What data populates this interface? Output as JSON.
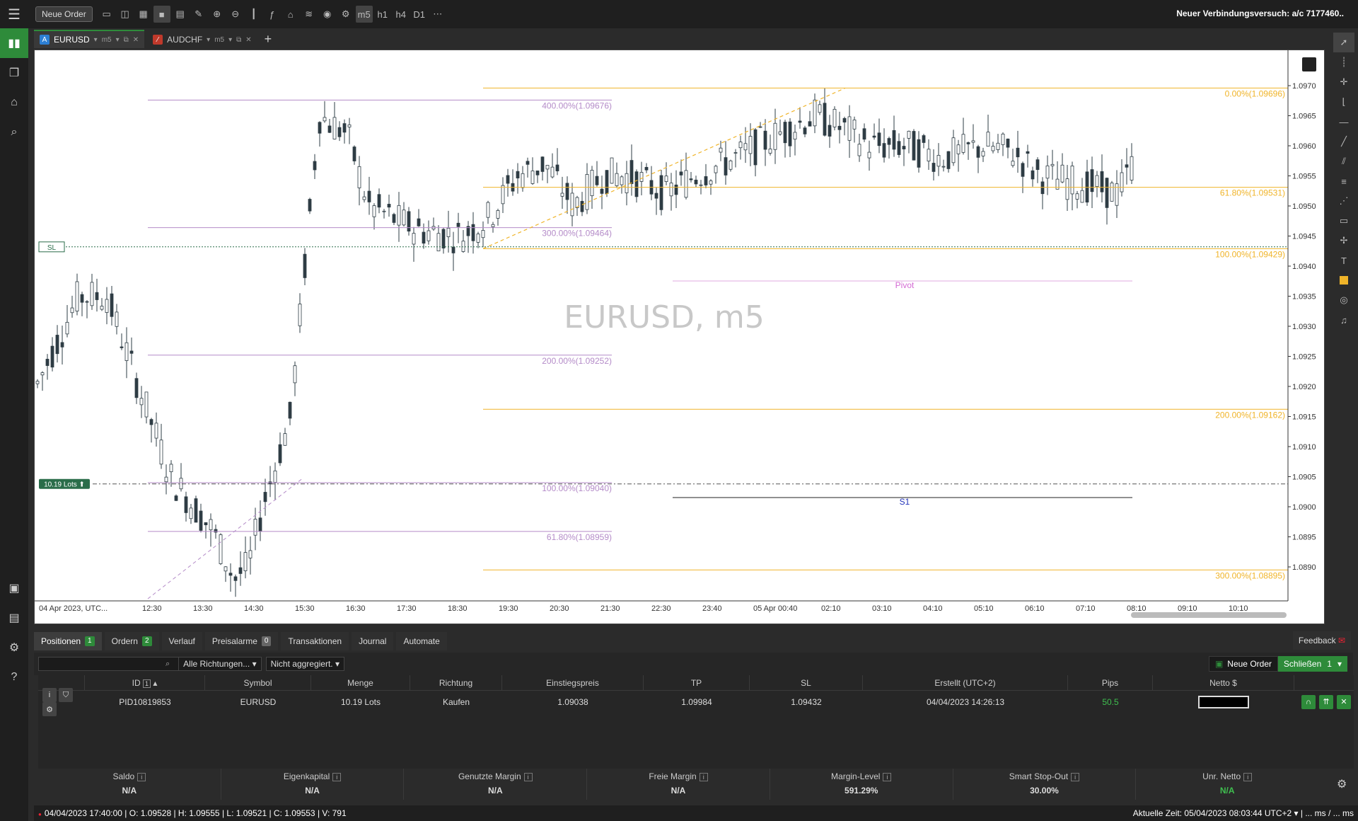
{
  "topbar": {
    "new_order_label": "Neue Order",
    "connection_status": "Neuer Verbindungsversuch: a/c 7177460..",
    "timeframes": [
      "m5",
      "h1",
      "h4",
      "D1"
    ],
    "more": "⋯"
  },
  "tabs": [
    {
      "symbol": "EURUSD",
      "timeframe": "m5",
      "badge": "A",
      "badge_color": "#2d7fd3"
    },
    {
      "symbol": "AUDCHF",
      "timeframe": "m5",
      "badge": "",
      "badge_color": "#c0392b"
    }
  ],
  "chart": {
    "watermark": "EURUSD, m5",
    "sl_label": "SL",
    "lots_label": "10.19 Lots",
    "pivot_label": "Pivot",
    "s1_label": "S1",
    "fib_purple": [
      {
        "label": "400.00%(1.09676)",
        "price": 1.09676
      },
      {
        "label": "300.00%(1.09464)",
        "price": 1.09464
      },
      {
        "label": "200.00%(1.09252)",
        "price": 1.09252
      },
      {
        "label": "100.00%(1.09040)",
        "price": 1.0904
      },
      {
        "label": "61.80%(1.08959)",
        "price": 1.08959
      }
    ],
    "fib_yellow": [
      {
        "label": "0.00%(1.09696)",
        "price": 1.09696
      },
      {
        "label": "61.80%(1.09531)",
        "price": 1.09531
      },
      {
        "label": "100.00%(1.09429)",
        "price": 1.09429
      },
      {
        "label": "200.00%(1.09162)",
        "price": 1.09162
      },
      {
        "label": "300.00%(1.08895)",
        "price": 1.08895
      }
    ],
    "price_ticks": [
      "1.0970",
      "1.0965",
      "1.0960",
      "1.0955",
      "1.0950",
      "1.0945",
      "1.0940",
      "1.0935",
      "1.0930",
      "1.0925",
      "1.0920",
      "1.0915",
      "1.0910",
      "1.0905",
      "1.0900",
      "1.0895",
      "1.0890"
    ],
    "time_ticks": [
      "04 Apr 2023, UTC...",
      "12:30",
      "13:30",
      "14:30",
      "15:30",
      "16:30",
      "17:30",
      "18:30",
      "19:30",
      "20:30",
      "21:30",
      "22:30",
      "23:40",
      "05 Apr 00:40",
      "02:10",
      "03:10",
      "04:10",
      "05:10",
      "06:10",
      "07:10",
      "08:10",
      "09:10",
      "10:10"
    ],
    "colors": {
      "purple": "#b48bc8",
      "yellow": "#f0b429",
      "candle": "#2e3c44"
    }
  },
  "panel": {
    "tabs": [
      {
        "label": "Positionen",
        "count": "1"
      },
      {
        "label": "Ordern",
        "count": "2"
      },
      {
        "label": "Verlauf",
        "count": ""
      },
      {
        "label": "Preisalarme",
        "count": "0"
      },
      {
        "label": "Transaktionen",
        "count": ""
      },
      {
        "label": "Journal",
        "count": ""
      },
      {
        "label": "Automate",
        "count": ""
      }
    ],
    "feedback": "Feedback",
    "filter_direction": "Alle Richtungen...",
    "filter_agg": "Nicht aggregiert.",
    "new_order": "Neue Order",
    "close_label": "Schließen",
    "close_count": "1",
    "columns": [
      "ID",
      "Symbol",
      "Menge",
      "Richtung",
      "Einstiegspreis",
      "TP",
      "SL",
      "Erstellt (UTC+2)",
      "Pips",
      "Netto $"
    ],
    "id_badge": "1",
    "row": {
      "id": "PID10819853",
      "symbol": "EURUSD",
      "menge": "10.19 Lots",
      "richtung": "Kaufen",
      "einstieg": "1.09038",
      "tp": "1.09984",
      "sl": "1.09432",
      "erstellt": "04/04/2023 14:26:13",
      "pips": "50.5"
    }
  },
  "summary": [
    {
      "label": "Saldo",
      "value": "N/A"
    },
    {
      "label": "Eigenkapital",
      "value": "N/A"
    },
    {
      "label": "Genutzte Margin",
      "value": "N/A"
    },
    {
      "label": "Freie Margin",
      "value": "N/A"
    },
    {
      "label": "Margin-Level",
      "value": "591.29%"
    },
    {
      "label": "Smart Stop-Out",
      "value": "30.00%"
    },
    {
      "label": "Unr. Netto",
      "value": "N/A"
    }
  ],
  "status": {
    "ohlc": "04/04/2023 17:40:00 |  O: 1.09528 |  H: 1.09555 |  L: 1.09521 |  C: 1.09553 |  V: 791",
    "time": "Aktuelle Zeit:  05/04/2023 08:03:44   UTC+2  ▾   |  ... ms / ... ms"
  }
}
